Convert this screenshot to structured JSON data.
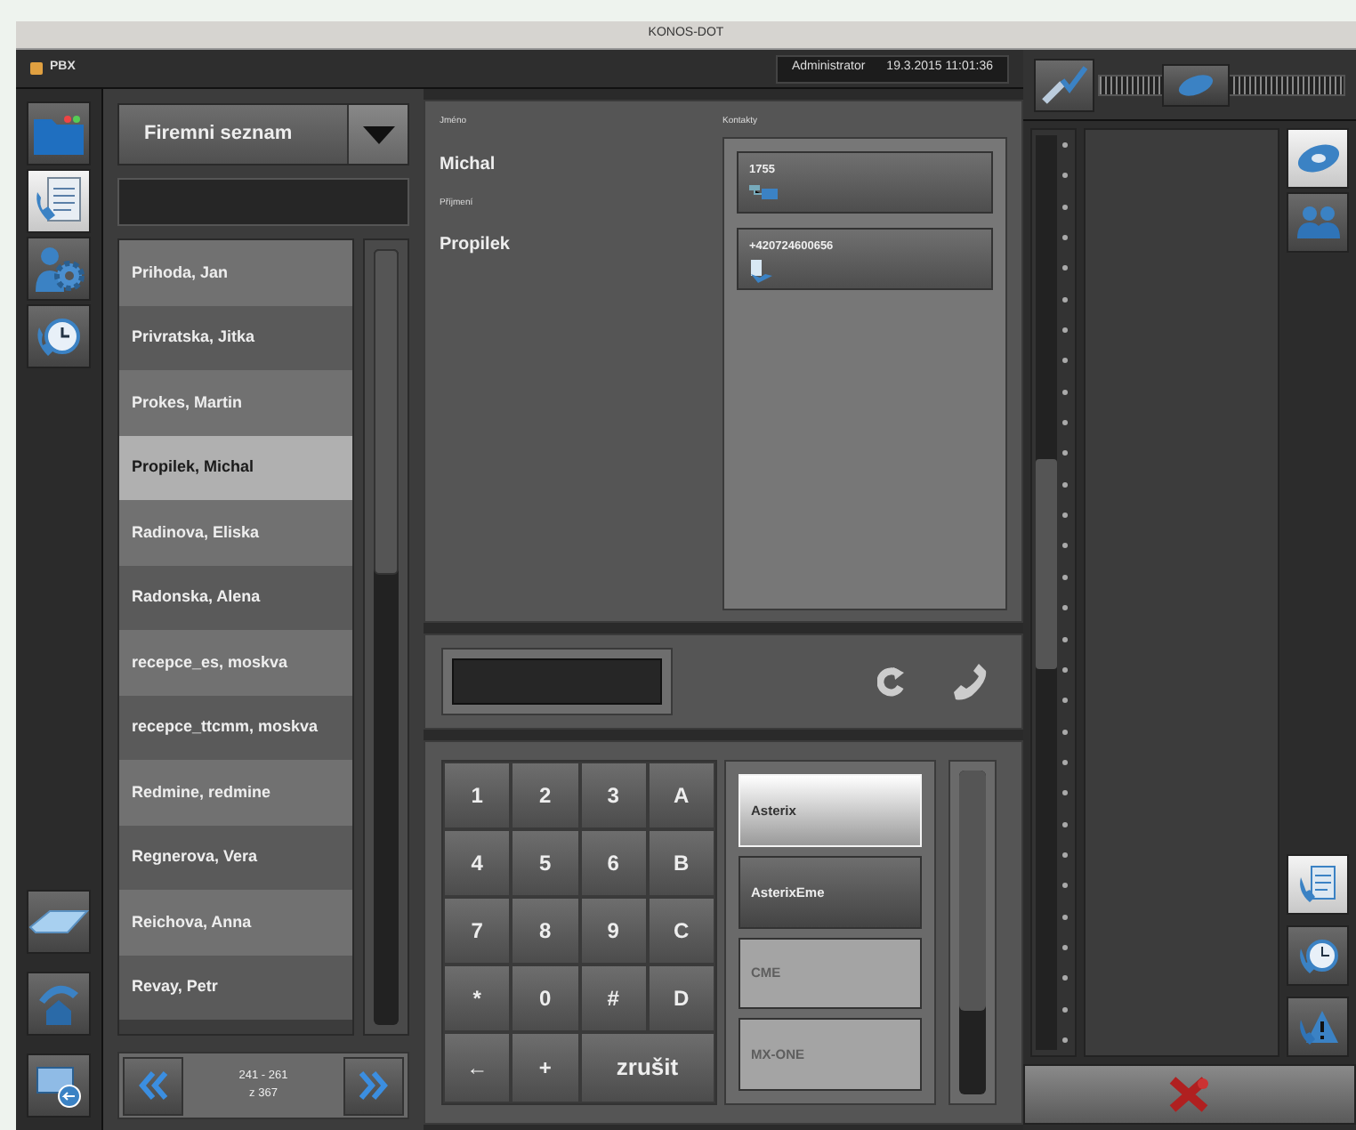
{
  "window": {
    "title": "KONOS-DOT"
  },
  "header": {
    "app": "PBX",
    "user": "Administrator",
    "datetime": "19.3.2015 11:01:36"
  },
  "nav_rail": [
    {
      "selected": false
    },
    {
      "selected": true
    },
    {
      "selected": false
    },
    {
      "selected": false
    }
  ],
  "directory": {
    "source": "Firemni seznam"
  },
  "contacts": [
    {
      "name": "Prihoda, Jan",
      "selected": false
    },
    {
      "name": "Privratska, Jitka",
      "selected": false
    },
    {
      "name": "Prokes, Martin",
      "selected": false
    },
    {
      "name": "Propilek, Michal",
      "selected": true
    },
    {
      "name": "Radinova, Eliska",
      "selected": false
    },
    {
      "name": "Radonska, Alena",
      "selected": false
    },
    {
      "name": "recepce_es, moskva",
      "selected": false
    },
    {
      "name": "recepce_ttcmm, moskva",
      "selected": false
    },
    {
      "name": "Redmine, redmine",
      "selected": false
    },
    {
      "name": "Regnerova, Vera",
      "selected": false
    },
    {
      "name": "Reichova, Anna",
      "selected": false
    },
    {
      "name": "Revay, Petr",
      "selected": false
    }
  ],
  "pager": {
    "range": "241 - 261",
    "total": "z 367"
  },
  "detail": {
    "first_name_label": "Jméno",
    "first_name": "Michal",
    "last_name_label": "Příjmení",
    "last_name": "Propilek",
    "contacts_label": "Kontakty",
    "numbers": [
      {
        "number": "1755",
        "kind": "extension"
      },
      {
        "number": "+420724600656",
        "kind": "mobile"
      }
    ]
  },
  "dialer": {
    "keys": [
      "1",
      "2",
      "3",
      "A",
      "4",
      "5",
      "6",
      "B",
      "7",
      "8",
      "9",
      "C",
      "*",
      "0",
      "#",
      "D",
      "←",
      "+",
      "zrušit"
    ]
  },
  "servers": [
    {
      "name": "Asterix",
      "selected": true,
      "disabled": false
    },
    {
      "name": "AsterixEme",
      "selected": false,
      "disabled": false
    },
    {
      "name": "CME",
      "selected": false,
      "disabled": true
    },
    {
      "name": "MX-ONE",
      "selected": false,
      "disabled": true
    }
  ],
  "toolbar_slider": {
    "level": 0.35
  },
  "side_tabs_top": [
    {
      "selected": true
    },
    {
      "selected": false
    }
  ],
  "side_tabs_bottom": [
    {
      "selected": true
    },
    {
      "selected": false
    },
    {
      "selected": false
    }
  ]
}
